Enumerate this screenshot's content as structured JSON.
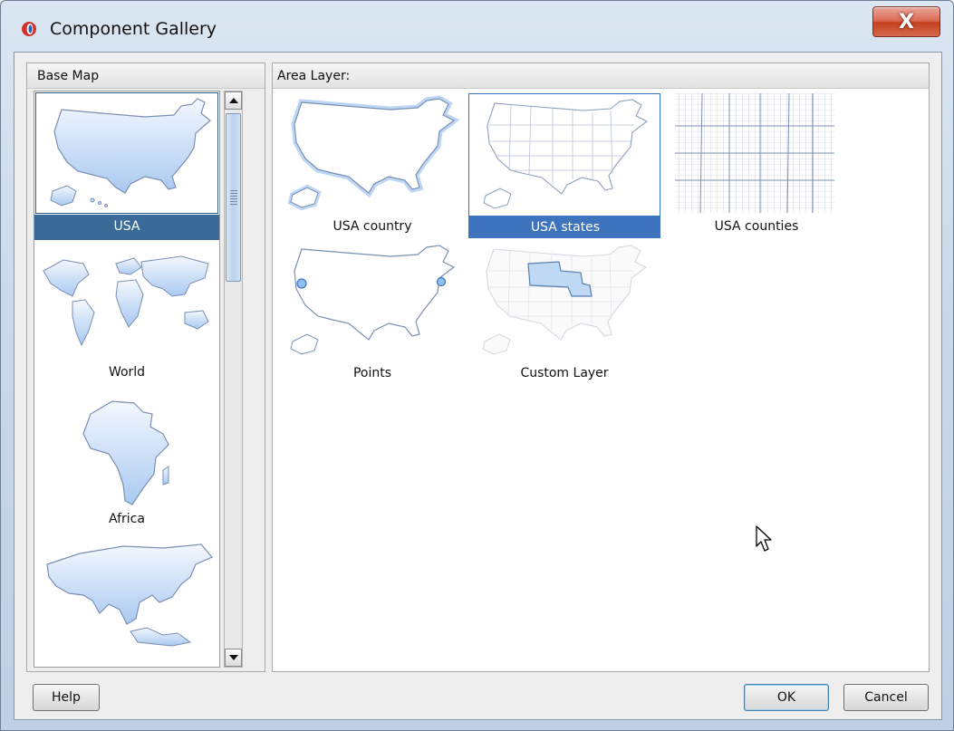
{
  "window": {
    "title": "Component Gallery",
    "close_glyph": "X"
  },
  "base_map": {
    "header": "Base Map",
    "items": [
      {
        "label": "USA",
        "selected": true,
        "icon": "usa-map-icon"
      },
      {
        "label": "World",
        "selected": false,
        "icon": "world-map-icon"
      },
      {
        "label": "Africa",
        "selected": false,
        "icon": "africa-map-icon"
      },
      {
        "label": "",
        "selected": false,
        "icon": "asia-map-icon"
      }
    ]
  },
  "area_layer": {
    "header": "Area Layer:",
    "items": [
      {
        "label": "USA country",
        "selected": false,
        "icon": "usa-country-outline-icon"
      },
      {
        "label": "USA states",
        "selected": true,
        "icon": "usa-states-map-icon"
      },
      {
        "label": "USA counties",
        "selected": false,
        "icon": "usa-counties-map-icon"
      },
      {
        "label": "Points",
        "selected": false,
        "icon": "usa-points-map-icon"
      },
      {
        "label": "Custom Layer",
        "selected": false,
        "icon": "custom-layer-map-icon"
      }
    ]
  },
  "buttons": {
    "help": "Help",
    "ok": "OK",
    "cancel": "Cancel"
  },
  "colors": {
    "selection_base": "#3a6a98",
    "selection_area": "#3d74bd",
    "map_fill": "#c6dcf6",
    "map_stroke": "#7a8fb3"
  }
}
